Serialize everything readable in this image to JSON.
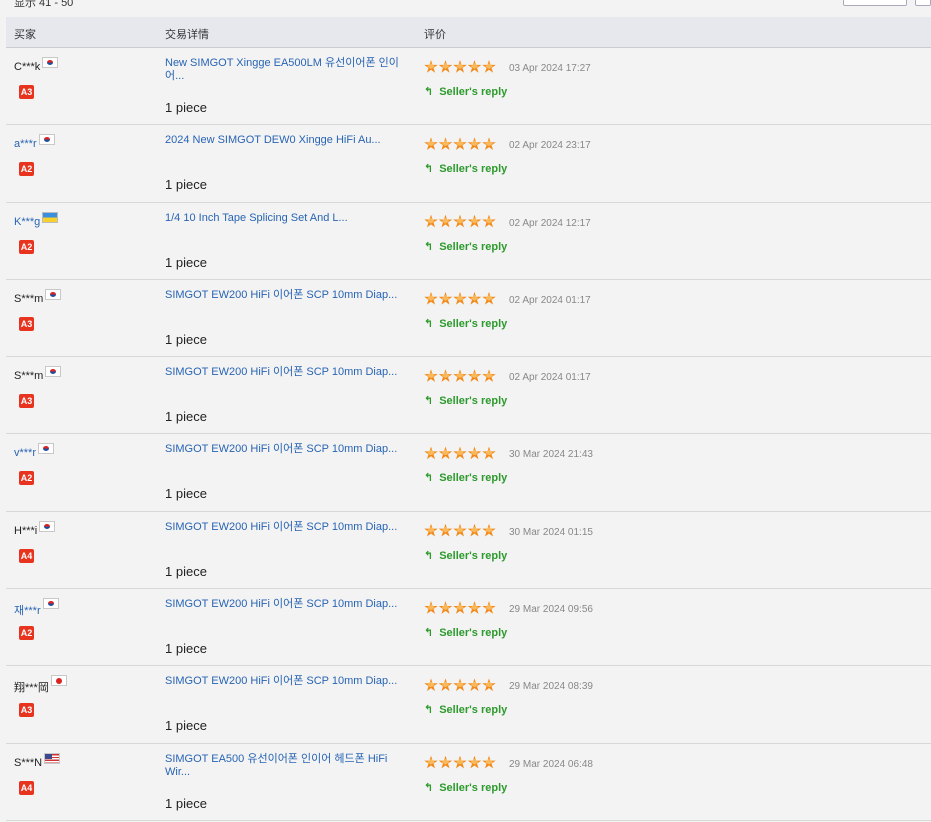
{
  "pager": {
    "range": "显示 41 - 50"
  },
  "columns": {
    "buyer": "买家",
    "detail": "交易详情",
    "rating": "评价"
  },
  "reply_label": "Seller's reply",
  "reply_icon": "reply-arrow-icon",
  "rows": [
    {
      "buyer": "C***k",
      "buyer_link": false,
      "flag": "kr",
      "level": "A3",
      "product": "New SIMGOT Xingge EA500LM 유선이어폰 인이어...",
      "qty": "1 piece",
      "stars": 5,
      "date": "03 Apr 2024 17:27"
    },
    {
      "buyer": "a***r",
      "buyer_link": true,
      "flag": "kr",
      "level": "A2",
      "product": "2024 New SIMGOT DEW0 Xingge HiFi Au...",
      "qty": "1 piece",
      "stars": 5,
      "date": "02 Apr 2024 23:17"
    },
    {
      "buyer": "K***g",
      "buyer_link": true,
      "flag": "ua",
      "level": "A2",
      "product": "1/4 10 Inch Tape Splicing Set And L...",
      "qty": "1 piece",
      "stars": 5,
      "date": "02 Apr 2024 12:17"
    },
    {
      "buyer": "S***m",
      "buyer_link": false,
      "flag": "kr",
      "level": "A3",
      "product": "SIMGOT EW200 HiFi 이어폰 SCP 10mm Diap...",
      "qty": "1 piece",
      "stars": 5,
      "date": "02 Apr 2024 01:17"
    },
    {
      "buyer": "S***m",
      "buyer_link": false,
      "flag": "kr",
      "level": "A3",
      "product": "SIMGOT EW200 HiFi 이어폰 SCP 10mm Diap...",
      "qty": "1 piece",
      "stars": 5,
      "date": "02 Apr 2024 01:17"
    },
    {
      "buyer": "v***r",
      "buyer_link": true,
      "flag": "kr",
      "level": "A2",
      "product": "SIMGOT EW200 HiFi 이어폰 SCP 10mm Diap...",
      "qty": "1 piece",
      "stars": 5,
      "date": "30 Mar 2024 21:43"
    },
    {
      "buyer": "H***i",
      "buyer_link": false,
      "flag": "kr",
      "level": "A4",
      "product": "SIMGOT EW200 HiFi 이어폰 SCP 10mm Diap...",
      "qty": "1 piece",
      "stars": 5,
      "date": "30 Mar 2024 01:15"
    },
    {
      "buyer": "재***r",
      "buyer_link": true,
      "flag": "kr",
      "level": "A2",
      "product": "SIMGOT EW200 HiFi 이어폰 SCP 10mm Diap...",
      "qty": "1 piece",
      "stars": 5,
      "date": "29 Mar 2024 09:56"
    },
    {
      "buyer": "翔***岡",
      "buyer_link": false,
      "flag": "jp",
      "level": "A3",
      "product": "SIMGOT EW200 HiFi 이어폰 SCP 10mm Diap...",
      "qty": "1 piece",
      "stars": 5,
      "date": "29 Mar 2024 08:39"
    },
    {
      "buyer": "S***N",
      "buyer_link": false,
      "flag": "us",
      "level": "A4",
      "product": "SIMGOT EA500 유선이어폰 인이어 헤드폰 HiFi Wir...",
      "qty": "1 piece",
      "stars": 5,
      "date": "29 Mar 2024 06:48"
    }
  ]
}
